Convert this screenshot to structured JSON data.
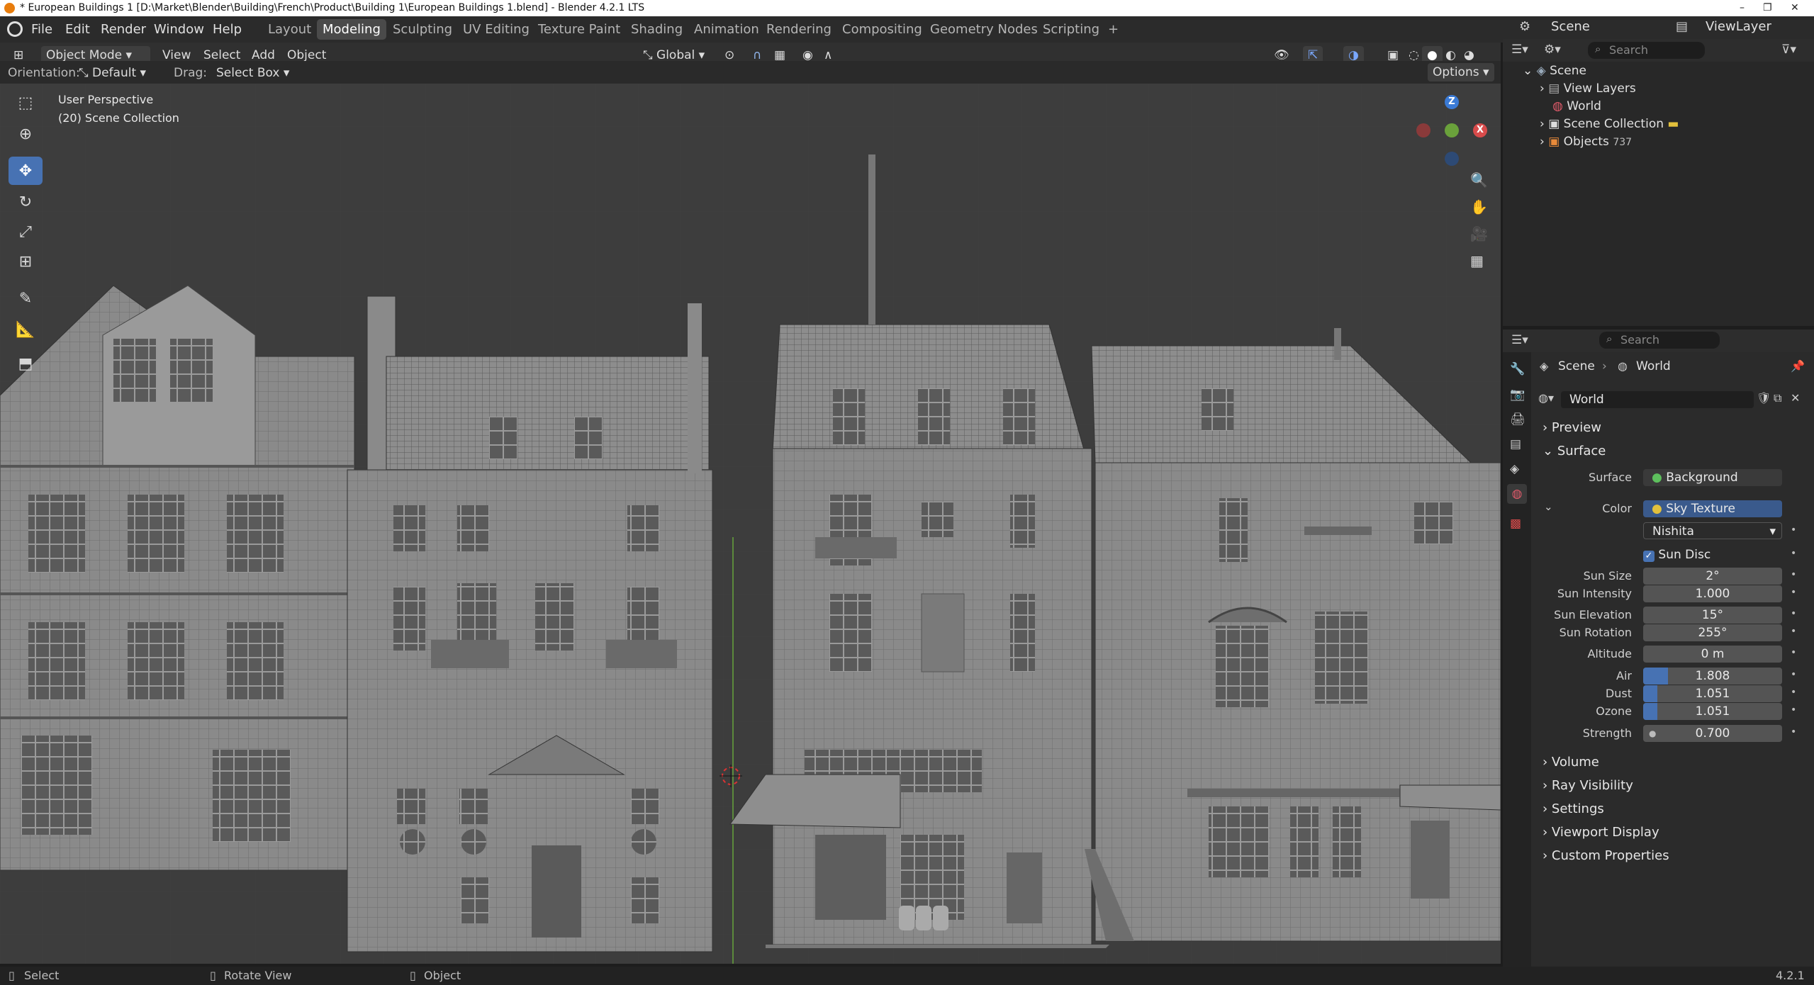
{
  "window": {
    "title": "* European Buildings 1 [D:\\Market\\Blender\\Building\\French\\Product\\Building 1\\European Buildings 1.blend] - Blender 4.2.1 LTS",
    "minimize": "–",
    "maximize": "❐",
    "close": "✕"
  },
  "menu": {
    "file": "File",
    "edit": "Edit",
    "render": "Render",
    "window": "Window",
    "help": "Help"
  },
  "workspaces": [
    "Layout",
    "Modeling",
    "Sculpting",
    "UV Editing",
    "Texture Paint",
    "Shading",
    "Animation",
    "Rendering",
    "Compositing",
    "Geometry Nodes",
    "Scripting"
  ],
  "workspace_add": "+",
  "scene_selector": {
    "scene": "Scene",
    "view_layer": "ViewLayer"
  },
  "viewport_header": {
    "mode": "Object Mode",
    "view": "View",
    "select": "Select",
    "add": "Add",
    "object": "Object",
    "transform": "Global",
    "orientation_label": "Orientation:",
    "orientation_value": "Default",
    "drag_label": "Drag:",
    "drag_value": "Select Box",
    "options": "Options"
  },
  "viewport": {
    "perspective": "User Perspective",
    "collection": "(20) Scene Collection",
    "gizmo": {
      "z": "Z",
      "y": "Y",
      "x": "X"
    }
  },
  "tools": [
    "select-box",
    "cursor",
    "move",
    "rotate",
    "scale",
    "transform",
    "annotate",
    "measure",
    "add-cube"
  ],
  "outliner": {
    "search_placeholder": "Search",
    "items": [
      {
        "label": "Scene"
      },
      {
        "label": "View Layers"
      },
      {
        "label": "World"
      },
      {
        "label": "Scene Collection"
      },
      {
        "label": "Objects",
        "count": "737"
      }
    ]
  },
  "properties": {
    "search_placeholder": "Search",
    "breadcrumb": {
      "scene": "Scene",
      "world": "World"
    },
    "datablock": "World",
    "panels": {
      "preview": "Preview",
      "surface": "Surface",
      "volume": "Volume",
      "ray_visibility": "Ray Visibility",
      "settings": "Settings",
      "viewport_display": "Viewport Display",
      "custom_properties": "Custom Properties"
    },
    "surface": {
      "surface_label": "Surface",
      "surface_value": "Background",
      "color_label": "Color",
      "color_value": "Sky Texture",
      "sky_type": "Nishita",
      "sun_disc": "Sun Disc",
      "sun_size_label": "Sun Size",
      "sun_size": "2°",
      "sun_intensity_label": "Sun Intensity",
      "sun_intensity": "1.000",
      "sun_elevation_label": "Sun Elevation",
      "sun_elevation": "15°",
      "sun_rotation_label": "Sun Rotation",
      "sun_rotation": "255°",
      "altitude_label": "Altitude",
      "altitude": "0 m",
      "air_label": "Air",
      "air": "1.808",
      "air_fill": 0.18,
      "dust_label": "Dust",
      "dust": "1.051",
      "dust_fill": 0.1,
      "ozone_label": "Ozone",
      "ozone": "1.051",
      "ozone_fill": 0.1,
      "strength_label": "Strength",
      "strength": "0.700"
    }
  },
  "statusbar": {
    "select": "Select",
    "rotate": "Rotate View",
    "object": "Object",
    "version": "4.2.1"
  },
  "colors": {
    "accent": "#4772b3",
    "active_tab": "#4a4a4a",
    "viewport_bg": "#3d3d3d"
  }
}
